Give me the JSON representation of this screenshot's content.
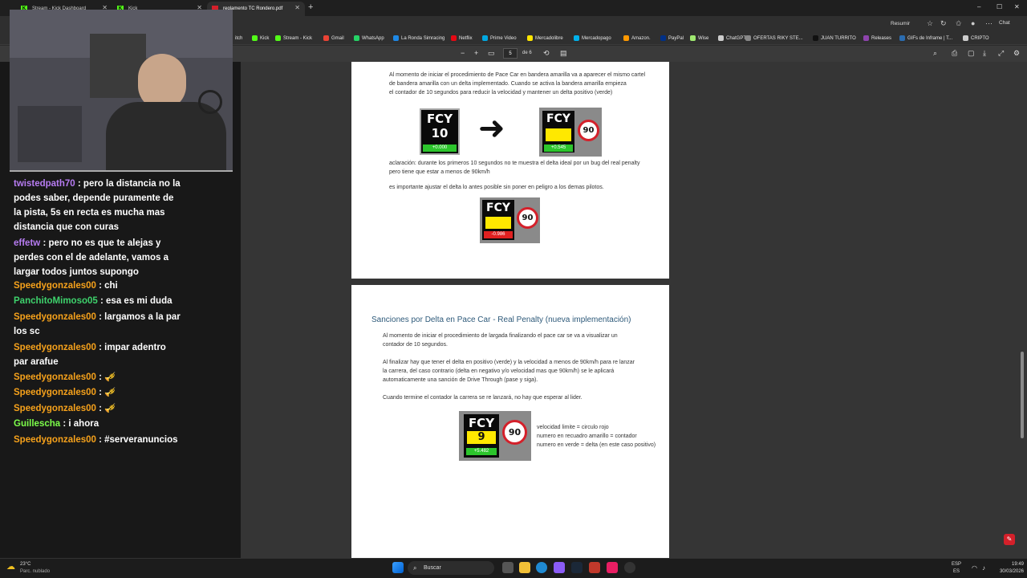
{
  "browser": {
    "tabs": [
      {
        "label": "Stream - Kick Dashboard"
      },
      {
        "label": "Kick"
      },
      {
        "label": "reglamento TC Rondero.pdf"
      }
    ],
    "new_tab": "+",
    "resumir": "Resumir",
    "chat": "Chat",
    "window_controls": {
      "min": "–",
      "max": "☐",
      "close": "✕"
    }
  },
  "bookmarks": [
    {
      "label": "itch",
      "color": "#6441a5"
    },
    {
      "label": "Kick",
      "color": "#53fc18"
    },
    {
      "label": "Stream - Kick",
      "color": "#53fc18"
    },
    {
      "label": "Gmail",
      "color": "#ea4335"
    },
    {
      "label": "WhatsApp",
      "color": "#25d366"
    },
    {
      "label": "La Ronda Simracing",
      "color": "#1e88e5"
    },
    {
      "label": "Netflix",
      "color": "#e50914"
    },
    {
      "label": "Prime Video",
      "color": "#00a8e1"
    },
    {
      "label": "Mercadolibre",
      "color": "#ffe600"
    },
    {
      "label": "Mercadopago",
      "color": "#00b1ea"
    },
    {
      "label": "Amazon.",
      "color": "#ff9900"
    },
    {
      "label": "PayPal",
      "color": "#003087"
    },
    {
      "label": "Wise",
      "color": "#9fe870"
    },
    {
      "label": "ChatGPT",
      "color": "#cccccc"
    },
    {
      "label": "OFERTAS RIKY STE...",
      "color": "#888888"
    },
    {
      "label": "JUAN TURRITO",
      "color": "#111111"
    },
    {
      "label": "Releases",
      "color": "#8e44ad"
    },
    {
      "label": "GIFs de Inframe | T...",
      "color": "#2b6cb0"
    },
    {
      "label": "CRIPTO",
      "color": "#cccccc"
    }
  ],
  "pdf_toolbar": {
    "page_current": "5",
    "page_total": "de 6"
  },
  "pdf": {
    "page_top": {
      "intro": [
        "Al momento de iniciar el procedimiento de Pace Car en bandera amarilla va a aparecer el mismo cartel",
        "de bandera amarilla con un delta implementado. Cuando se activa la bandera amarilla empieza",
        "el contador de 10 segundos para reducir la velocidad y mantener un delta positivo (verde)"
      ],
      "note": [
        "aclaración: durante los primeros 10 segundos no te muestra el delta ideal por un bug del real penalty",
        "pero tiene que estar a menos de 90km/h"
      ],
      "important": "es importante ajustar el delta lo antes posible sin poner en peligro a los demas pilotos.",
      "fcy1": {
        "label": "FCY",
        "number": "10",
        "delta": "+0.000"
      },
      "arrow": "➜",
      "fcy2": {
        "label": "FCY",
        "delta": "+0.545",
        "speed": "90"
      },
      "fcy3": {
        "label": "FCY",
        "delta": "-0.986",
        "speed": "90"
      }
    },
    "page_bottom": {
      "title": "Sanciones por Delta en Pace Car -  Real Penalty (nueva implementación)",
      "p1": [
        "Al momento de iniciar el procedimiento de largada finalizando el pace car se va a visualizar un",
        "contador de 10 segundos."
      ],
      "p2": [
        "Al finalizar hay que tener el delta en positivo (verde) y la velocidad a menos de 90km/h para re lanzar",
        "la carrera, del caso contrario (delta en negativo y/o velocidad mas que 90km/h) se le aplicará",
        "automaticamente una sanción de Drive Through (pase y siga)."
      ],
      "p3": "Cuando termine el contador la carrera se re lanzará, no hay que esperar al lider.",
      "fcy4": {
        "label": "FCY",
        "number": "9",
        "delta": "+5.482",
        "speed": "90"
      },
      "legend": [
        "velocidad limite = circulo rojo",
        "numero en recuadro amarillo = contador",
        "numero en verde = delta (en este caso positivo)"
      ]
    }
  },
  "chat": {
    "messages": [
      {
        "user": "twistedpath70",
        "text": ": pero la distancia no la podes saber, depende puramente de la pista, 5s en recta es mucha mas distancia que con curas",
        "color": "#b77cf2"
      },
      {
        "user": "effetw",
        "text": ": pero no es que te alejas y perdes con el de adelante, vamos a largar todos juntos supongo",
        "color": "#b77cf2"
      },
      {
        "user": "Speedygonzales00",
        "text": ": chi",
        "color": "#f7a21b"
      },
      {
        "user": "PanchitoMimoso05",
        "text": ": esa es mi duda",
        "color": "#3ed26c"
      },
      {
        "user": "Speedygonzales00",
        "text": ": largamos a la par los sc",
        "color": "#f7a21b"
      },
      {
        "user": "Speedygonzales00",
        "text": ": impar adentro par arafue",
        "color": "#f7a21b"
      },
      {
        "user": "Speedygonzales00",
        "text": ": 🎺",
        "color": "#f7a21b"
      },
      {
        "user": "Speedygonzales00",
        "text": ": 🎺",
        "color": "#f7a21b"
      },
      {
        "user": "Speedygonzales00",
        "text": ": 🎺",
        "color": "#f7a21b"
      },
      {
        "user": "Guillescha",
        "text": ": i ahora",
        "color": "#7dff4a"
      },
      {
        "user": "Speedygonzales00",
        "text": ": #serveranuncios",
        "color": "#f7a21b"
      }
    ]
  },
  "taskbar": {
    "weather_temp": "23°C",
    "weather_desc": "Parc. nublado",
    "search_placeholder": "Buscar",
    "lang": "ESP",
    "lang_sub": "ES",
    "time": "19:49",
    "date": "30/03/2026"
  }
}
